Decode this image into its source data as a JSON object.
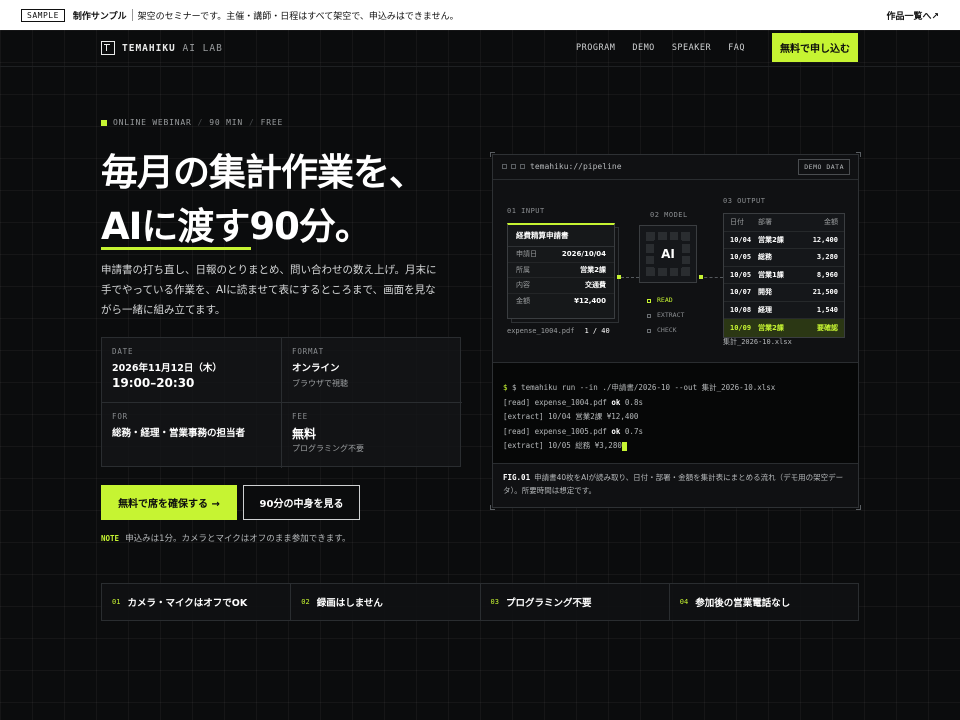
{
  "notice": {
    "badge": "SAMPLE",
    "label": "制作サンプル",
    "message": "架空のセミナーです。主催・講師・日程はすべて架空で、申込みはできません。",
    "link": "作品一覧へ↗"
  },
  "header": {
    "brand": "TEMAHIKU",
    "brand_sub": "AI LAB",
    "nav": [
      "PROGRAM",
      "DEMO",
      "SPEAKER",
      "FAQ"
    ],
    "cta": "無料で申し込む"
  },
  "hero": {
    "eyebrow": [
      "ONLINE WEBINAR",
      "90 MIN",
      "FREE"
    ],
    "title_line1": "毎月の集計作業を、",
    "title_line2": "AIに渡す90分。",
    "lead": "申請書の打ち直し、日報のとりまとめ、問い合わせの数え上げ。月末に手でやっている作業を、AIに読ませて表にするところまで、画面を見ながら一緒に組み立てます。"
  },
  "info": {
    "date": {
      "label": "DATE",
      "value": "2026年11月12日（木）",
      "time": "19:00–20:30"
    },
    "format": {
      "label": "FORMAT",
      "value": "オンライン",
      "sub": "ブラウザで視聴"
    },
    "for": {
      "label": "FOR",
      "value": "総務・経理・営業事務の担当者"
    },
    "fee": {
      "label": "FEE",
      "value": "無料",
      "sub": "プログラミング不要"
    }
  },
  "actions": {
    "primary": "無料で席を確保する →",
    "secondary": "90分の中身を見る",
    "note_label": "NOTE",
    "note": "申込みは1分。カメラとマイクはオフのまま参加できます。"
  },
  "pipeline": {
    "path": "temahiku://pipeline",
    "badge": "DEMO DATA",
    "input_label": "01 INPUT",
    "model_label": "02 MODEL",
    "output_label": "03 OUTPUT",
    "doc_title": "経費精算申請書",
    "doc_rows": [
      {
        "k": "申請日",
        "v": "2026/10/04"
      },
      {
        "k": "所属",
        "v": "営業2課"
      },
      {
        "k": "内容",
        "v": "交通費"
      },
      {
        "k": "金額",
        "v": "¥12,400"
      }
    ],
    "doc_file": "expense_1004.pdf",
    "doc_page": "1 / 40",
    "model_name": "AI",
    "steps": [
      "READ",
      "EXTRACT",
      "CHECK"
    ],
    "table_header": [
      "日付",
      "部署",
      "金額"
    ],
    "table_rows": [
      [
        "10/04",
        "営業2課",
        "12,400"
      ],
      [
        "10/05",
        "総務",
        "3,280"
      ],
      [
        "10/05",
        "営業1課",
        "8,960"
      ],
      [
        "10/07",
        "開発",
        "21,500"
      ],
      [
        "10/08",
        "経理",
        "1,540"
      ],
      [
        "10/09",
        "営業2課",
        "要確認"
      ]
    ],
    "output_file": "集計_2026-10.xlsx",
    "terminal": [
      "$ temahiku run --in ./申請書/2026-10 --out 集計_2026-10.xlsx",
      "[read] expense_1004.pdf ok 0.8s",
      "[extract] 10/04 営業2課 ¥12,400",
      "[read] expense_1005.pdf ok 0.7s",
      "[extract] 10/05 総務 ¥3,280"
    ],
    "fig_label": "FIG.01",
    "fig_caption": "申請書40枚をAIが読み取り、日付・部署・金額を集計表にまとめる流れ（デモ用の架空データ）。所要時間は想定です。"
  },
  "features": [
    {
      "num": "01",
      "text": "カメラ・マイクはオフでOK"
    },
    {
      "num": "02",
      "text": "録画はしません"
    },
    {
      "num": "03",
      "text": "プログラミング不要"
    },
    {
      "num": "04",
      "text": "参加後の営業電話なし"
    }
  ],
  "colors": {
    "accent": "#c6f432",
    "background": "#0b0c0d"
  }
}
